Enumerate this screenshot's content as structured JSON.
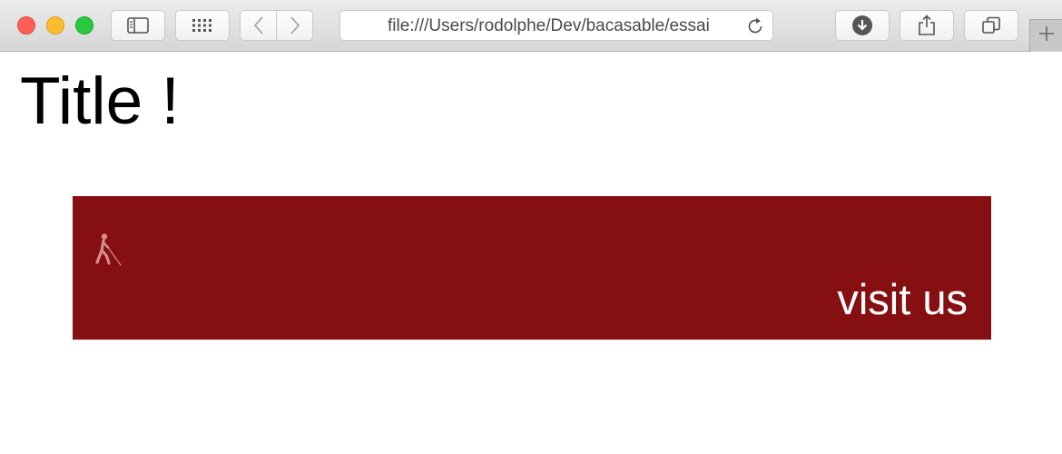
{
  "browser": {
    "address_url": "file:///Users/rodolphe/Dev/bacasable/essai",
    "icons": {
      "sidebar": "sidebar-icon",
      "top_sites": "grid-icon",
      "back": "chevron-left-icon",
      "forward": "chevron-right-icon",
      "reload": "reload-icon",
      "downloads": "download-icon",
      "share": "share-icon",
      "tabs": "tabs-icon",
      "new_tab": "plus-icon"
    }
  },
  "page": {
    "title": "Title !",
    "banner": {
      "background_color": "#861011",
      "icon": "blind-person-with-cane-icon",
      "link_text": "visit us"
    }
  }
}
